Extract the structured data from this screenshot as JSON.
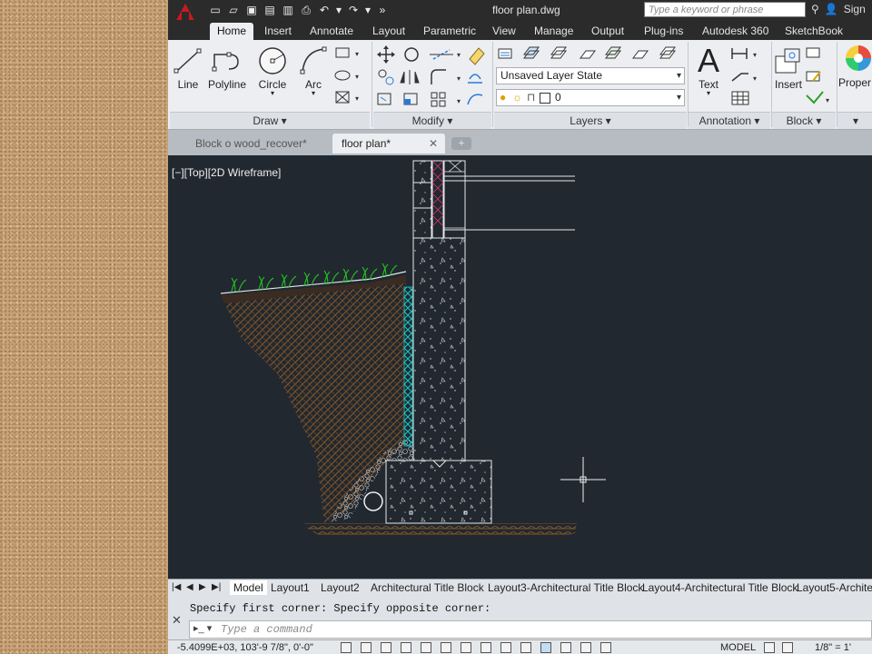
{
  "app": {
    "document_title": "floor plan.dwg",
    "search_placeholder": "Type a keyword or phrase",
    "sign_in": "Sign"
  },
  "ribbon_tabs": [
    "Home",
    "Insert",
    "Annotate",
    "Layout",
    "Parametric",
    "View",
    "Manage",
    "Output",
    "Plug-ins",
    "Autodesk 360",
    "SketchBook Design"
  ],
  "ribbon": {
    "draw_tools": [
      "Line",
      "Polyline",
      "Circle",
      "Arc"
    ],
    "panels": {
      "draw": "Draw",
      "modify": "Modify",
      "layers": "Layers",
      "annotation": "Annotation",
      "block": "Block"
    },
    "layer_state": "Unsaved Layer State",
    "current_layer": "0",
    "text_label": "Text",
    "insert_label": "Insert",
    "properties_label": "Proper"
  },
  "file_tabs": [
    "Block o wood_recover*",
    "floor plan*"
  ],
  "viewport": {
    "label": "[−][Top][2D Wireframe]"
  },
  "layout_tabs": [
    "Model",
    "Layout1",
    "Layout2",
    "Architectural Title Block",
    "Layout3-Architectural Title Block",
    "Layout4-Architectural Title Block",
    "Layout5-Architec"
  ],
  "command": {
    "history": "Specify first corner: Specify opposite corner:",
    "placeholder": "Type a command"
  },
  "status": {
    "coordinates": "-5.4099E+03, 103'-9 7/8\", 0'-0\"",
    "model": "MODEL",
    "scale": "1/8\" = 1'"
  },
  "colors": {
    "accent": "#c8191e",
    "viewport_bg": "#212830",
    "grass": "#22c322",
    "insulation": "#19c8c8",
    "soil": "#8a5a2a"
  }
}
